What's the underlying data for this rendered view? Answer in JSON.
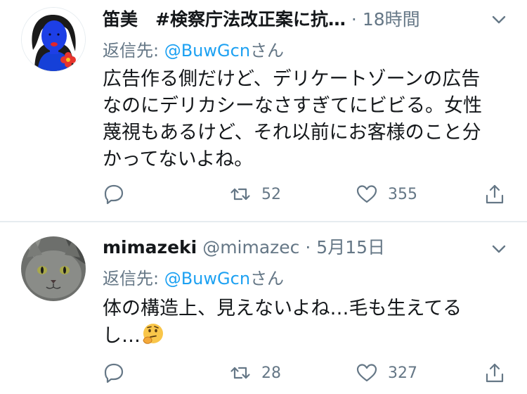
{
  "tweets": [
    {
      "name": "笛美　#検察庁法改正案に抗…",
      "handle": "",
      "dot": "·",
      "time": "18時間",
      "reply_prefix": "返信先: ",
      "reply_mention": "@BuwGcn",
      "reply_suffix": "さん",
      "lines": [
        "広告作る側だけど、デリケートゾーンの広告",
        "なのにデリカシーなさすぎてにビビる。女性",
        "蔑視もあるけど、それ以前にお客様のこと分",
        "かってないよね。"
      ],
      "retweets": "52",
      "likes": "355"
    },
    {
      "name": "mimazeki",
      "handle": "@mimazec",
      "dot": "·",
      "time": "5月15日",
      "reply_prefix": "返信先: ",
      "reply_mention": "@BuwGcn",
      "reply_suffix": "さん",
      "lines": [
        "体の構造上、見えないよね…毛も生えてる",
        "し…"
      ],
      "retweets": "28",
      "likes": "327"
    }
  ],
  "colors": {
    "text": "#14171a",
    "muted": "#657786",
    "accent": "#1da1f2",
    "divider": "#e6ecf0"
  },
  "icons": {
    "reply": "reply-icon",
    "retweet": "retweet-icon",
    "like": "heart-icon",
    "share": "share-icon",
    "more": "chevron-down-icon",
    "emoji": "thinking-face-emoji"
  }
}
